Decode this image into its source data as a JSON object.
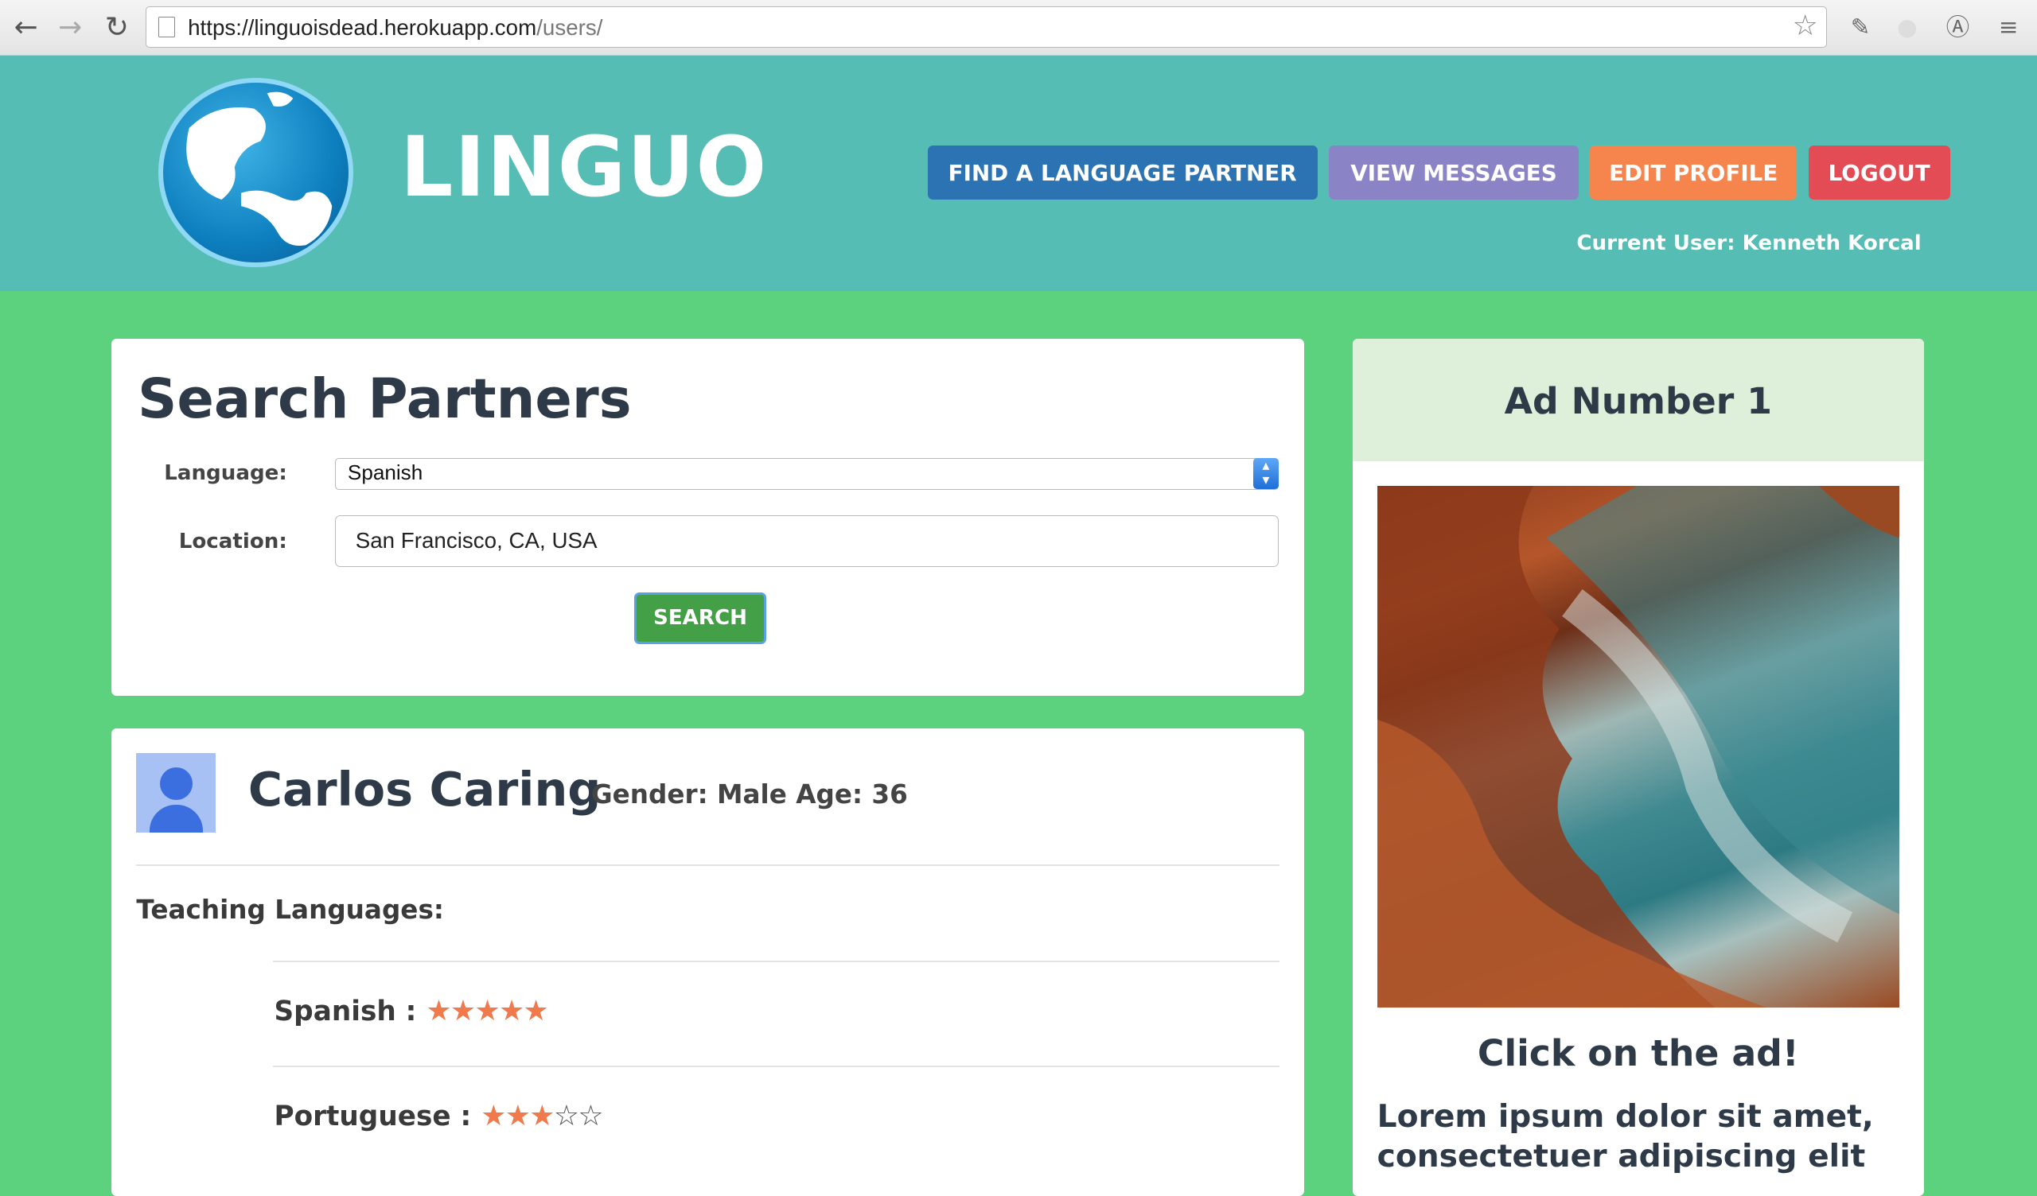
{
  "browser": {
    "url_host": "https://linguoisdead.herokuapp.com",
    "url_path": "/users/"
  },
  "header": {
    "logo_text": "LINGUO",
    "nav": [
      {
        "label": "FIND A LANGUAGE PARTNER",
        "color": "#2c73b3"
      },
      {
        "label": "VIEW MESSAGES",
        "color": "#8a84c6"
      },
      {
        "label": "EDIT PROFILE",
        "color": "#f6844d"
      },
      {
        "label": "LOGOUT",
        "color": "#e34c54"
      }
    ],
    "current_user": "Current User: Kenneth Korcal"
  },
  "search": {
    "title": "Search Partners",
    "language_label": "Language:",
    "language_value": "Spanish",
    "location_label": "Location:",
    "location_value": "San Francisco, CA, USA",
    "button_label": "SEARCH"
  },
  "partner": {
    "name": "Carlos Caring",
    "meta": "Gender: Male  Age: 36",
    "teaching_label": "Teaching Languages:",
    "languages": [
      {
        "label": "Spanish :",
        "rating": 5,
        "max": 5
      },
      {
        "label": "Portuguese :",
        "rating": 3,
        "max": 5
      }
    ]
  },
  "ad": {
    "title": "Ad Number 1",
    "cta": "Click on the ad!",
    "body": "Lorem ipsum dolor sit amet, consectetuer adipiscing elit"
  },
  "colors": {
    "page_bg": "#5dd27e",
    "header_bg": "#55bdb3",
    "star": "#f07a4c",
    "search_button": "#44a047"
  }
}
